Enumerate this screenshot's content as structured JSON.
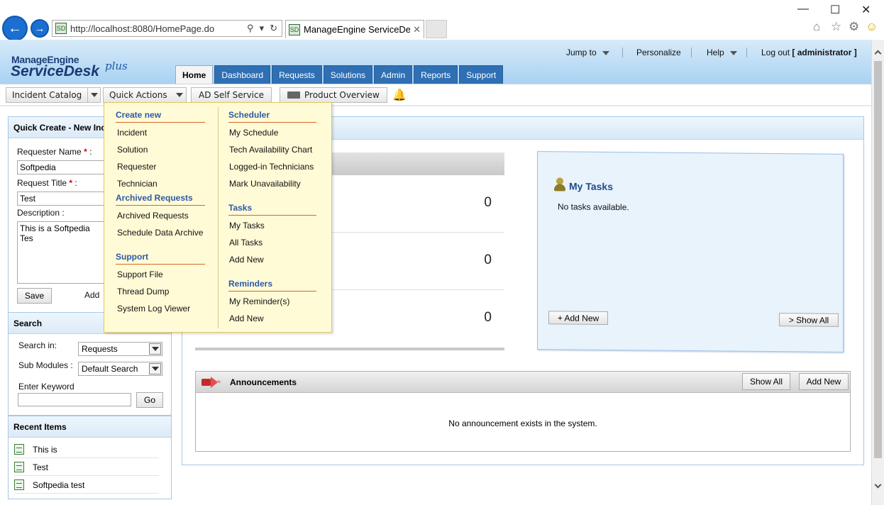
{
  "browser": {
    "url": "http://localhost:8080/HomePage.do",
    "tab_title": "ManageEngine ServiceDesk..."
  },
  "logo": {
    "top": "ManageEngine",
    "main": "ServiceDesk",
    "plus": "plus"
  },
  "top_links": {
    "jump_to": "Jump to",
    "personalize": "Personalize",
    "help": "Help",
    "logout_prefix": "Log out",
    "user": "[ administrator ]"
  },
  "tabs": [
    "Home",
    "Dashboard",
    "Requests",
    "Solutions",
    "Admin",
    "Reports",
    "Support"
  ],
  "toolbar": {
    "incident_catalog": "Incident Catalog",
    "quick_actions": "Quick Actions",
    "ad_self_service": "AD Self Service",
    "product_overview": "Product Overview"
  },
  "quick_create": {
    "title": "Quick Create - New Inc",
    "requester_label": "Requester Name",
    "requester_value": "Softpedia",
    "title_label": "Request Title",
    "title_value": "Test",
    "description_label": "Description :",
    "description_value": "This is a Softpedia Tes",
    "save": "Save",
    "add_more": "Add"
  },
  "search": {
    "title": "Search",
    "search_in_label": "Search in:",
    "search_in_value": "Requests",
    "sub_modules_label": "Sub Modules :",
    "sub_modules_value": "Default Search",
    "keyword_label": "Enter Keyword",
    "go": "Go"
  },
  "recent": {
    "title": "Recent Items",
    "items": [
      "This is",
      "Test",
      "Softpedia test"
    ]
  },
  "counts": [
    "0",
    "0",
    "0"
  ],
  "tasks": {
    "title": "My Tasks",
    "empty": "No tasks available.",
    "add_new": "+ Add New",
    "show_all": "> Show All"
  },
  "announcements": {
    "title": "Announcements",
    "show_all": "Show All",
    "add_new": "Add New",
    "empty": "No announcement exists in the system."
  },
  "quick_actions_menu": {
    "create_new": {
      "heading": "Create new",
      "items": [
        "Incident",
        "Solution",
        "Requester",
        "Technician"
      ]
    },
    "archived": {
      "heading": "Archived Requests",
      "items": [
        "Archived Requests",
        "Schedule Data Archive"
      ]
    },
    "support": {
      "heading": "Support",
      "items": [
        "Support File",
        "Thread Dump",
        "System Log Viewer"
      ]
    },
    "scheduler": {
      "heading": "Scheduler",
      "items": [
        "My Schedule",
        "Tech Availability Chart",
        "Logged-in Technicians",
        "Mark Unavailability"
      ]
    },
    "tasks": {
      "heading": "Tasks",
      "items": [
        "My Tasks",
        "All Tasks",
        "Add New"
      ]
    },
    "reminders": {
      "heading": "Reminders",
      "items": [
        "My Reminder(s)",
        "Add New"
      ]
    }
  }
}
